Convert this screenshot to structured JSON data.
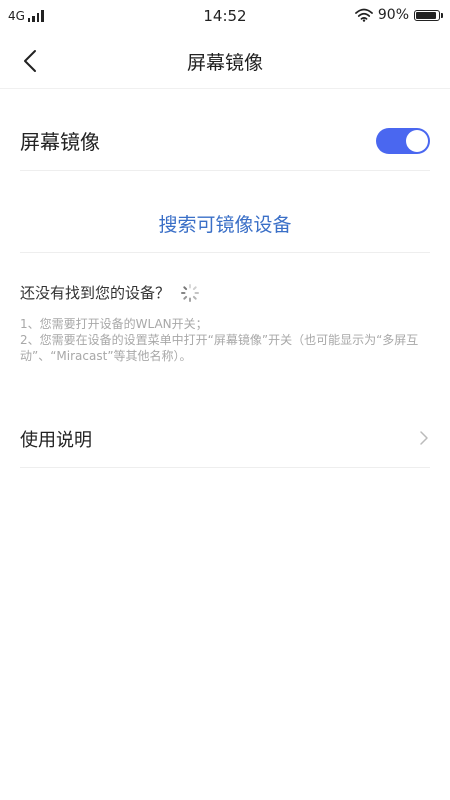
{
  "status_bar": {
    "network": "4G",
    "time": "14:52",
    "battery_text": "90%",
    "battery_level": 0.9
  },
  "nav": {
    "title": "屏幕镜像"
  },
  "mirror": {
    "label": "屏幕镜像",
    "enabled": true,
    "accent": "#4a67f0"
  },
  "search": {
    "label": "搜索可镜像设备",
    "color": "#3a6fc7"
  },
  "not_found": {
    "text": "还没有找到您的设备？"
  },
  "hints": {
    "line1": "1、您需要打开设备的WLAN开关；",
    "line2": "2、您需要在设备的设置菜单中打开“屏幕镜像”开关（也可能显示为“多屏互动”、“Miracast”等其他名称）。"
  },
  "usage": {
    "label": "使用说明"
  },
  "icons": {
    "back": "back-arrow-icon",
    "signal": "signal-icon",
    "wifi": "wifi-icon",
    "battery": "battery-icon",
    "spinner": "loading-spinner-icon",
    "chevron": "chevron-right-icon"
  }
}
